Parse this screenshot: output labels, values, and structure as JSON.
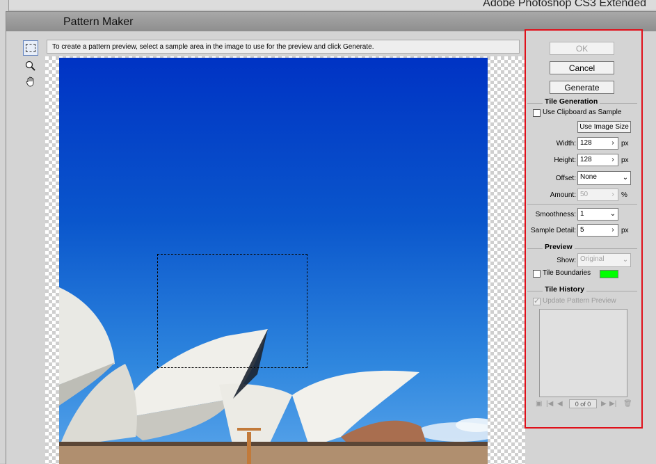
{
  "app": {
    "title": "Adobe Photoshop CS3 Extended"
  },
  "dialog": {
    "title": "Pattern Maker",
    "hint": "To create a pattern preview, select a sample area in the image to use for the preview and click Generate."
  },
  "tools": [
    {
      "name": "rectangular-marquee",
      "icon": "marquee-icon"
    },
    {
      "name": "zoom",
      "icon": "magnifier-icon"
    },
    {
      "name": "hand",
      "icon": "hand-icon"
    }
  ],
  "buttons": {
    "ok": "OK",
    "cancel": "Cancel",
    "generate": "Generate"
  },
  "tile_generation": {
    "title": "Tile Generation",
    "use_clipboard": "Use Clipboard as Sample",
    "use_image_size": "Use Image Size",
    "width_label": "Width:",
    "width_value": "128",
    "width_unit": "px",
    "height_label": "Height:",
    "height_value": "128",
    "height_unit": "px",
    "offset_label": "Offset:",
    "offset_value": "None",
    "amount_label": "Amount:",
    "amount_value": "50",
    "amount_unit": "%",
    "smoothness_label": "Smoothness:",
    "smoothness_value": "1",
    "detail_label": "Sample Detail:",
    "detail_value": "5",
    "detail_unit": "px"
  },
  "preview": {
    "title": "Preview",
    "show_label": "Show:",
    "show_value": "Original",
    "tile_boundaries": "Tile Boundaries",
    "boundary_color": "#00ff00"
  },
  "tile_history": {
    "title": "Tile History",
    "update_preview": "Update Pattern Preview",
    "counter": "0 of 0"
  },
  "colors": {
    "highlight": "#e0101a",
    "sky_top": "#0033c4",
    "sky_bottom": "#5aa5ea"
  }
}
